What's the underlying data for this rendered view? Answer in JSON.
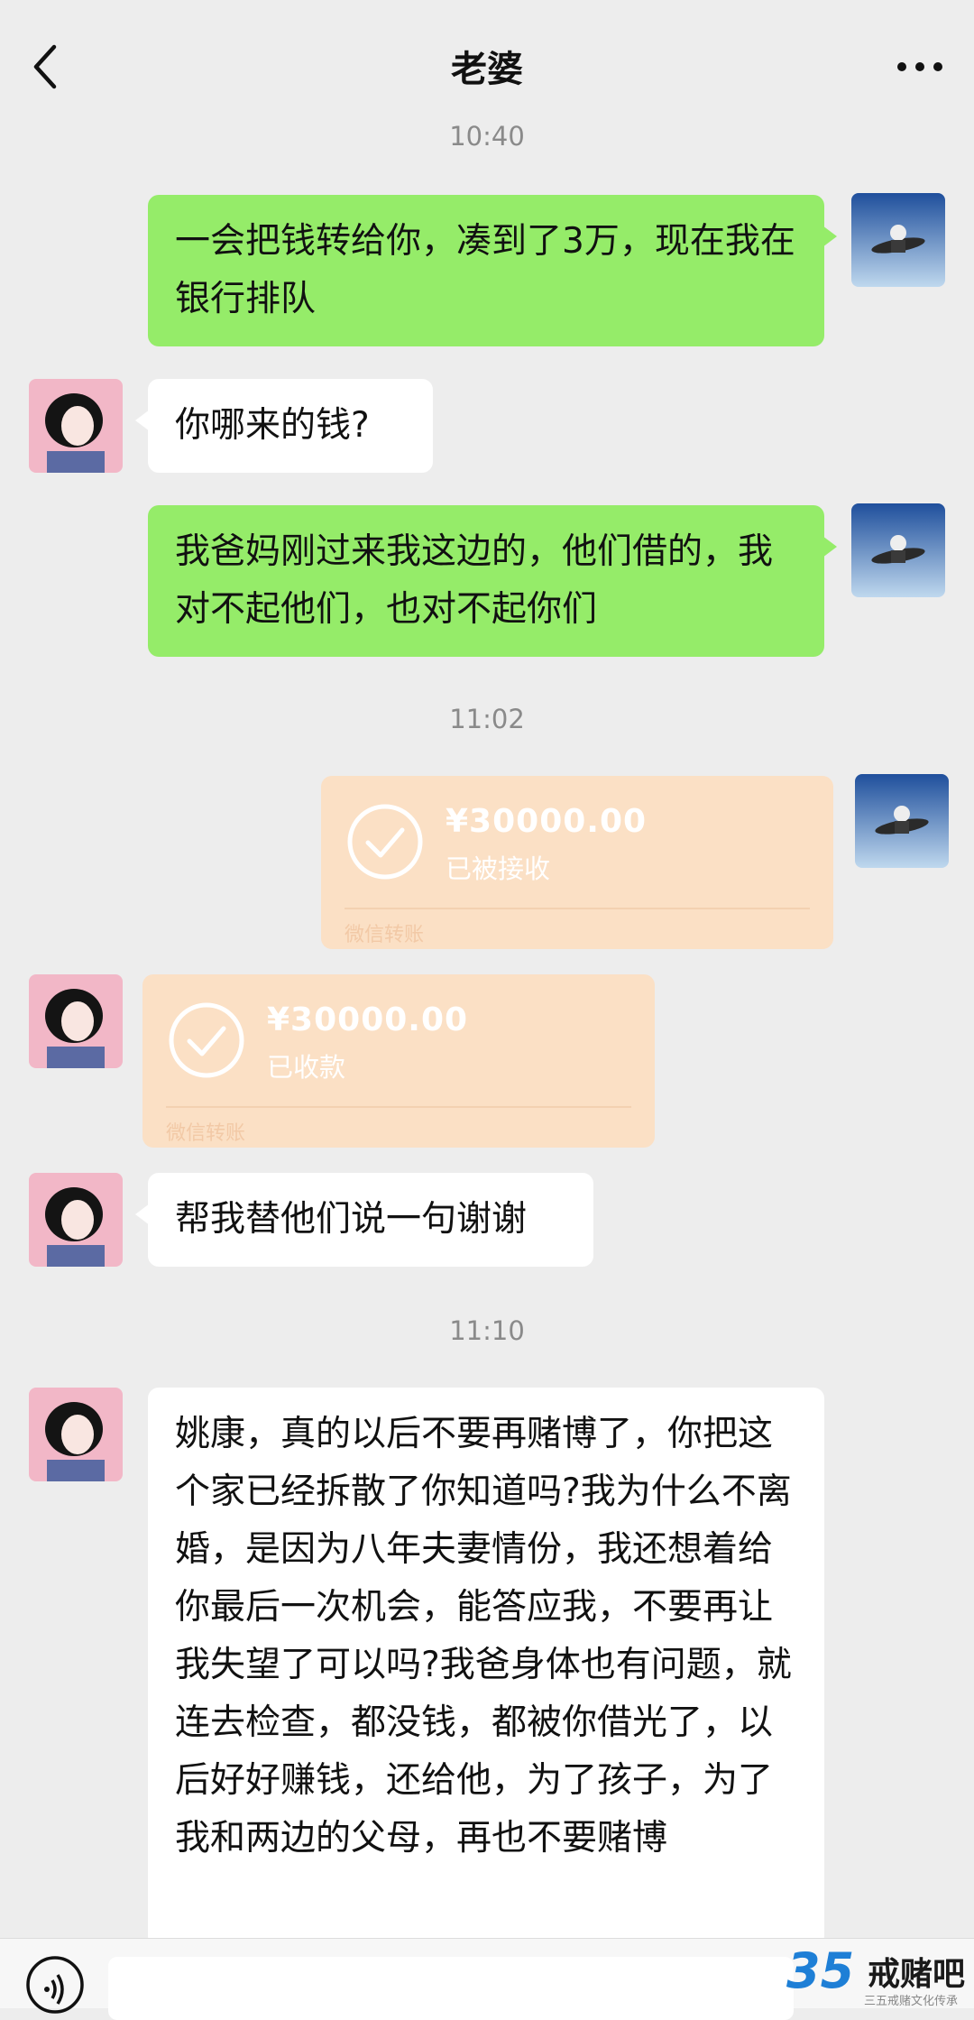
{
  "header": {
    "title": "老婆"
  },
  "timestamps": [
    "10:40",
    "11:02",
    "11:10"
  ],
  "messages": {
    "m1": "一会把钱转给你，凑到了3万，现在我在银行排队",
    "m2": "你哪来的钱?",
    "m3": "我爸妈刚过来我这边的，他们借的，我对不起他们，也对不起你们",
    "m4": "帮我替他们说一句谢谢",
    "m5": "姚康，真的以后不要再赌博了，你把这个家已经拆散了你知道吗?我为什么不离婚，是因为八年夫妻情份，我还想着给你最后一次机会，能答应我，不要再让我失望了可以吗?我爸身体也有问题，就连去检查，都没钱，都被你借光了，以后好好赚钱，还给他，为了孩子，为了我和两边的父母，再也不要赌博"
  },
  "transfers": {
    "sent": {
      "amount": "¥30000.00",
      "status": "已被接收",
      "label": "微信转账"
    },
    "received": {
      "amount": "¥30000.00",
      "status": "已收款",
      "label": "微信转账"
    }
  },
  "watermark": {
    "number": "35",
    "text": "戒赌吧",
    "sub": "三五戒赌文化传承"
  },
  "icons": [
    "back-icon",
    "more-icon",
    "check-icon",
    "voice-icon"
  ],
  "colors": {
    "sent_bubble": "#95ec69",
    "received_bubble": "#ffffff",
    "transfer_card": "#fbe0c5",
    "background": "#ededed"
  }
}
